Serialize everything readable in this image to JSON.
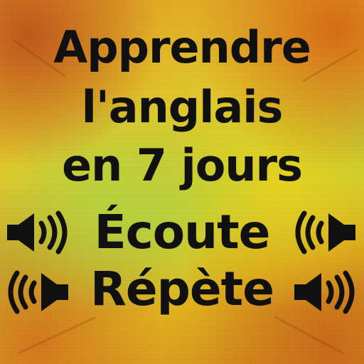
{
  "title_lines": [
    "Apprendre",
    "l'anglais",
    "en 7 jours"
  ],
  "words": {
    "listen": "Écoute",
    "repeat": "Répète"
  },
  "colors": {
    "text": "#111111",
    "background_warm": "#e39a1e",
    "background_green": "#b8d03a",
    "background_yellow": "#e6c21c"
  },
  "icons": [
    "speaker-right-icon",
    "speaker-left-icon",
    "speaker-left-icon",
    "speaker-right-icon"
  ]
}
